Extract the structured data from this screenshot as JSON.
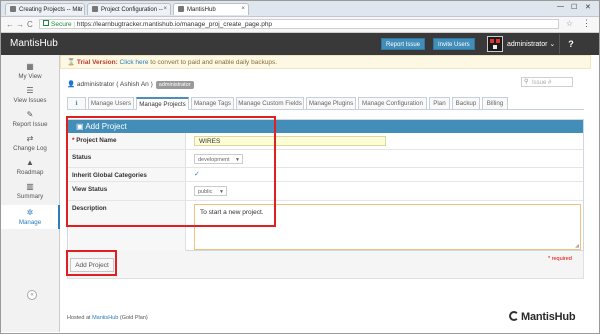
{
  "browser": {
    "tabs": [
      {
        "title": "Creating Projects -- Mar"
      },
      {
        "title": "Project Configuration -- "
      },
      {
        "title": "MantisHub"
      }
    ],
    "nav": {
      "back": "←",
      "forward": "→",
      "reload": "C"
    },
    "security": "Secure",
    "url": "https://learnbugtracker.mantishub.io/manage_proj_create_page.php",
    "window_controls": {
      "min": "—",
      "max": "☐",
      "close": "✕"
    }
  },
  "navbar": {
    "brand": "MantisHub",
    "report_issue": "Report Issue",
    "invite_users": "Invite Users",
    "user": "administrator",
    "help": "?"
  },
  "sidebar": {
    "items": [
      {
        "label": "My View",
        "icon": "dashboard-icon",
        "glyph": "▦"
      },
      {
        "label": "View Issues",
        "icon": "list-icon",
        "glyph": "☰"
      },
      {
        "label": "Report Issue",
        "icon": "pencil-icon",
        "glyph": "✎"
      },
      {
        "label": "Change Log",
        "icon": "retweet-icon",
        "glyph": "⇄"
      },
      {
        "label": "Roadmap",
        "icon": "road-icon",
        "glyph": "▲"
      },
      {
        "label": "Summary",
        "icon": "bar-chart-icon",
        "glyph": "▥"
      },
      {
        "label": "Manage",
        "icon": "gears-icon",
        "glyph": "✲"
      }
    ],
    "collapse": "«"
  },
  "trial": {
    "title": "Trial Version:",
    "link": "Click here",
    "text": "to convert to paid and enable daily backups."
  },
  "userbar": {
    "user": "administrator ( Ashish An )",
    "role": "administrator",
    "issue_placeholder": "Issue #"
  },
  "tabs": [
    {
      "label": "ℹ"
    },
    {
      "label": "Manage Users"
    },
    {
      "label": "Manage Projects"
    },
    {
      "label": "Manage Tags"
    },
    {
      "label": "Manage Custom Fields"
    },
    {
      "label": "Manage Plugins"
    },
    {
      "label": "Manage Configuration"
    },
    {
      "label": "Plan"
    },
    {
      "label": "Backup"
    },
    {
      "label": "Billing"
    }
  ],
  "form": {
    "title": "Add Project",
    "project_name_label": "Project Name",
    "required_mark": "*",
    "project_name_value": "WIRES",
    "status_label": "Status",
    "status_value": "development",
    "inherit_label": "Inherit Global Categories",
    "inherit_checked": true,
    "view_status_label": "View Status",
    "view_status_value": "public",
    "description_label": "Description",
    "description_value": "To start a new project.",
    "submit": "Add Project",
    "required_note": "* required"
  },
  "footer": {
    "prefix": "Hosted at",
    "link": "MantisHub",
    "suffix": "(Gold Plan)",
    "logo": "MantisHub"
  },
  "colors": {
    "accent": "#438eb9",
    "annotation": "#e02020",
    "navbar": "#393939"
  }
}
